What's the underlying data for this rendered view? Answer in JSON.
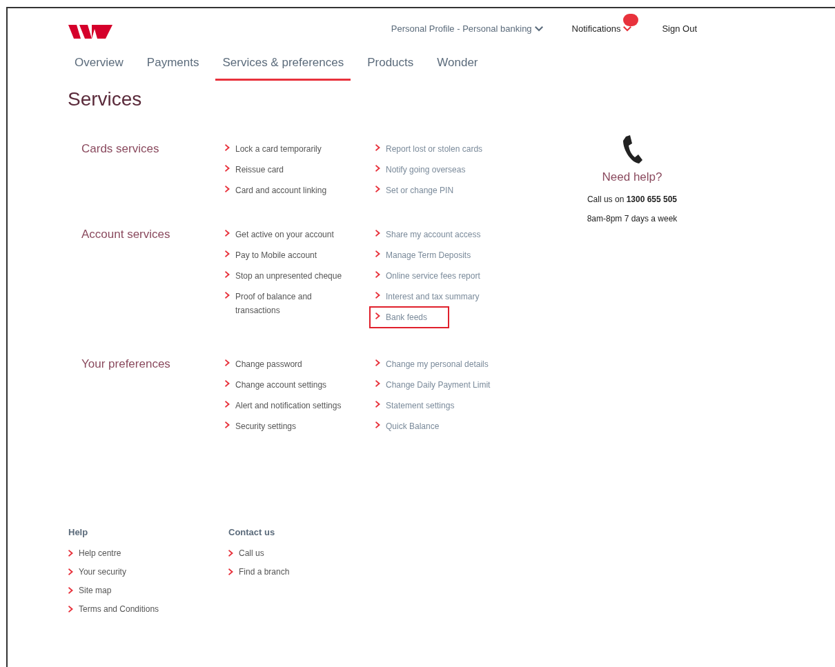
{
  "header": {
    "profile_menu": "Personal Profile - Personal banking",
    "notifications": "Notifications",
    "sign_out": "Sign Out"
  },
  "tabs": [
    {
      "label": "Overview",
      "selected": false
    },
    {
      "label": "Payments",
      "selected": false
    },
    {
      "label": "Services & preferences",
      "selected": true
    },
    {
      "label": "Products",
      "selected": false
    },
    {
      "label": "Wonder",
      "selected": false
    }
  ],
  "page_title": "Services",
  "sections": [
    {
      "title": "Cards services",
      "columns": [
        [
          {
            "label": "Lock a card temporarily",
            "highlighted": false
          },
          {
            "label": "Reissue card",
            "highlighted": false
          },
          {
            "label": "Card and account linking",
            "highlighted": false
          }
        ],
        [
          {
            "label": "Report lost or stolen cards",
            "highlighted": false
          },
          {
            "label": "Notify going overseas",
            "highlighted": false
          },
          {
            "label": "Set or change PIN",
            "highlighted": false
          }
        ]
      ]
    },
    {
      "title": "Account services",
      "columns": [
        [
          {
            "label": "Get active on your account",
            "highlighted": false
          },
          {
            "label": "Pay to Mobile account",
            "highlighted": false
          },
          {
            "label": "Stop an unpresented cheque",
            "highlighted": false
          },
          {
            "label": "Proof of balance and transactions",
            "highlighted": false
          }
        ],
        [
          {
            "label": "Share my account access",
            "highlighted": false
          },
          {
            "label": "Manage Term Deposits",
            "highlighted": false
          },
          {
            "label": "Online service fees report",
            "highlighted": false
          },
          {
            "label": "Interest and tax summary",
            "highlighted": false
          },
          {
            "label": "Bank feeds",
            "highlighted": true
          }
        ]
      ]
    },
    {
      "title": "Your preferences",
      "columns": [
        [
          {
            "label": "Change password",
            "highlighted": false
          },
          {
            "label": "Change account settings",
            "highlighted": false
          },
          {
            "label": "Alert and notification settings",
            "highlighted": false
          },
          {
            "label": "Security settings",
            "highlighted": false
          }
        ],
        [
          {
            "label": "Change my personal details",
            "highlighted": false
          },
          {
            "label": "Change Daily Payment Limit",
            "highlighted": false
          },
          {
            "label": "Statement settings",
            "highlighted": false
          },
          {
            "label": "Quick Balance",
            "highlighted": false
          }
        ]
      ]
    }
  ],
  "help_panel": {
    "title": "Need help?",
    "call_text": "Call us on **1300 655 505**",
    "hours": "8am-8pm  7 days a week"
  },
  "footer": [
    {
      "title": "Help",
      "links": [
        "Help centre",
        "Your security",
        "Site map",
        "Terms and Conditions"
      ]
    },
    {
      "title": "Contact us",
      "links": [
        "Call us",
        "Find a branch"
      ]
    }
  ]
}
